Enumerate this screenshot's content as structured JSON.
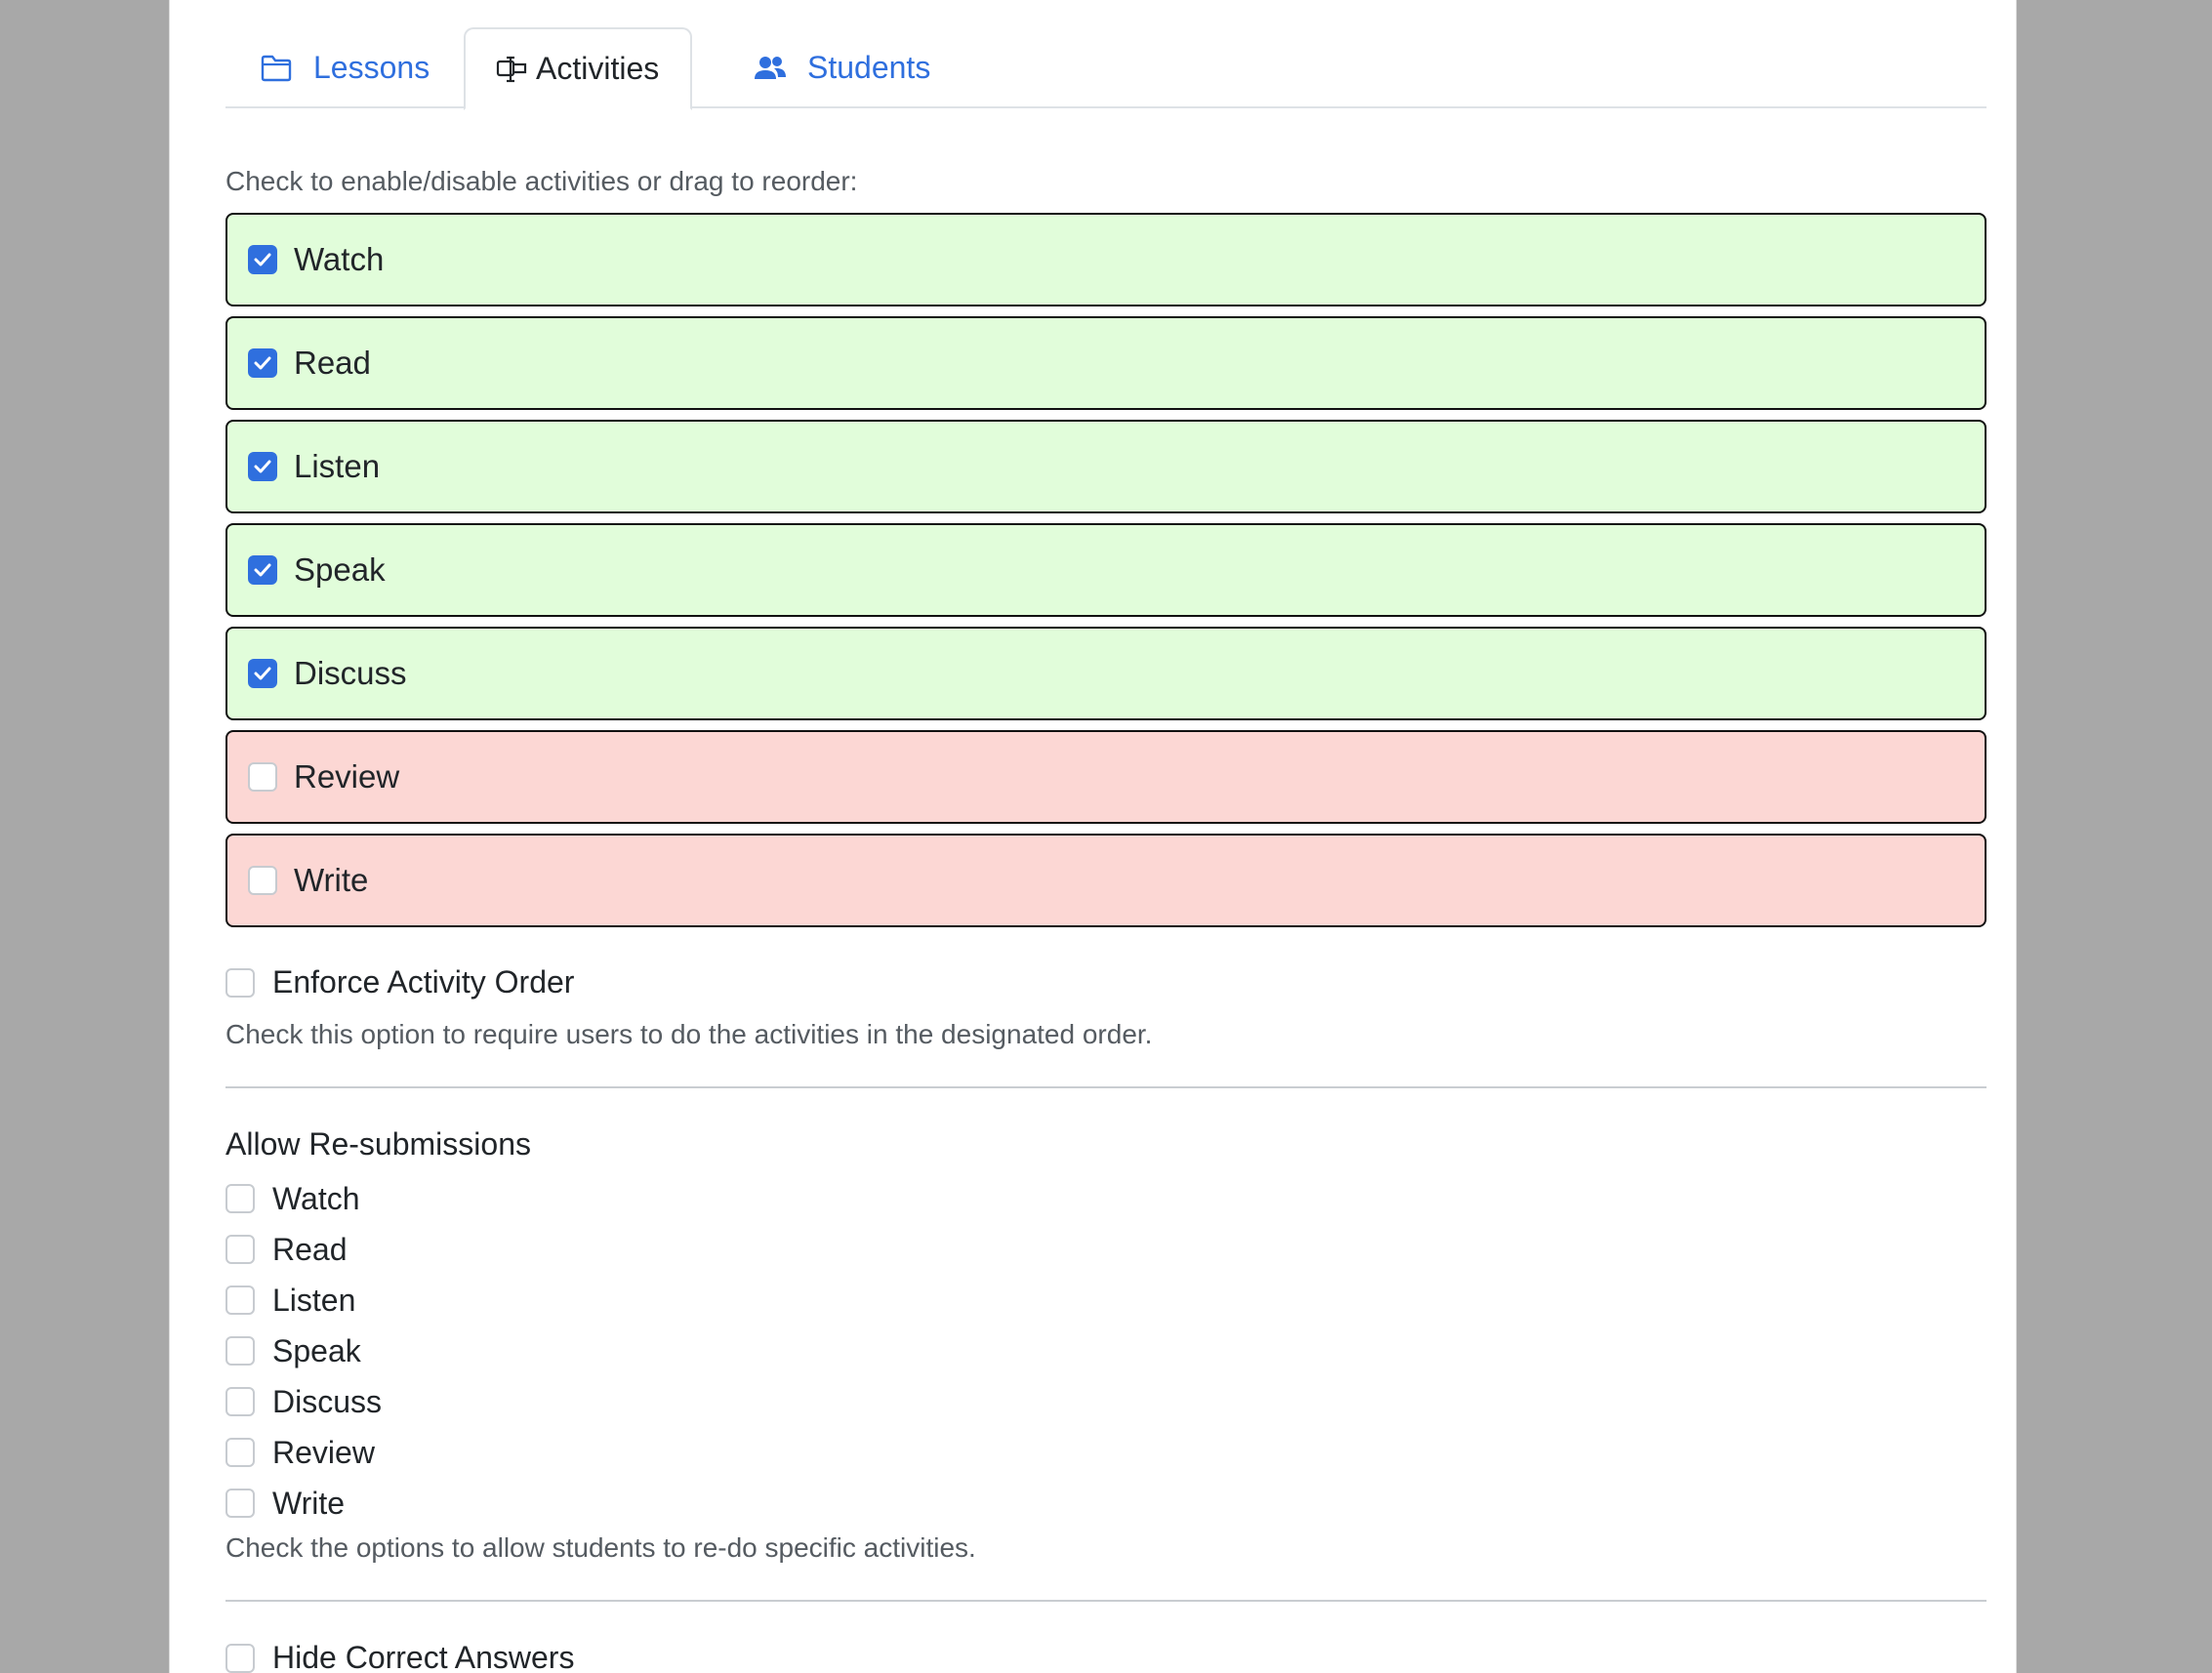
{
  "tabs": [
    {
      "label": "Lessons",
      "icon": "folder-icon",
      "active": false
    },
    {
      "label": "Activities",
      "icon": "activities-icon",
      "active": true
    },
    {
      "label": "Students",
      "icon": "users-icon",
      "active": false
    }
  ],
  "colors": {
    "accent": "#2f6fde",
    "enabled_bg": "#e1fdda",
    "disabled_bg": "#fcd7d4"
  },
  "activities": {
    "instruction": "Check to enable/disable activities or drag to reorder:",
    "items": [
      {
        "label": "Watch",
        "enabled": true
      },
      {
        "label": "Read",
        "enabled": true
      },
      {
        "label": "Listen",
        "enabled": true
      },
      {
        "label": "Speak",
        "enabled": true
      },
      {
        "label": "Discuss",
        "enabled": true
      },
      {
        "label": "Review",
        "enabled": false
      },
      {
        "label": "Write",
        "enabled": false
      }
    ]
  },
  "enforce_order": {
    "label": "Enforce Activity Order",
    "checked": false,
    "help": "Check this option to require users to do the activities in the designated order."
  },
  "resubmissions": {
    "title": "Allow Re-submissions",
    "items": [
      {
        "label": "Watch",
        "checked": false
      },
      {
        "label": "Read",
        "checked": false
      },
      {
        "label": "Listen",
        "checked": false
      },
      {
        "label": "Speak",
        "checked": false
      },
      {
        "label": "Discuss",
        "checked": false
      },
      {
        "label": "Review",
        "checked": false
      },
      {
        "label": "Write",
        "checked": false
      }
    ],
    "help": "Check the options to allow students to re-do specific activities."
  },
  "hide_answers": {
    "label": "Hide Correct Answers",
    "checked": false
  }
}
